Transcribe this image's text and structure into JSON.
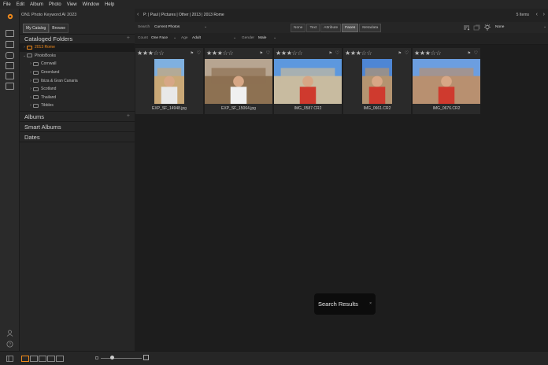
{
  "menu": [
    "File",
    "Edit",
    "Album",
    "Photo",
    "View",
    "Window",
    "Help"
  ],
  "app_title": "ON1 Photo Keyword AI 2023",
  "sidebar": {
    "tabs": [
      {
        "label": "My Catalog",
        "active": true
      },
      {
        "label": "Browse",
        "active": false
      }
    ],
    "cataloged_folders": "Cataloged Folders",
    "tree": [
      {
        "label": "2013 Rome",
        "depth": 1,
        "selected": true,
        "caret": "›"
      },
      {
        "label": "PhotoBooks",
        "depth": 1,
        "selected": false,
        "caret": "⌄"
      },
      {
        "label": "Cornwall",
        "depth": 2,
        "selected": false,
        "caret": "›"
      },
      {
        "label": "Greenland",
        "depth": 2,
        "selected": false,
        "caret": "›"
      },
      {
        "label": "Ibiza & Gran Canaria",
        "depth": 2,
        "selected": false,
        "caret": "›"
      },
      {
        "label": "Scotland",
        "depth": 2,
        "selected": false,
        "caret": "›"
      },
      {
        "label": "Thailand",
        "depth": 2,
        "selected": false,
        "caret": "›"
      },
      {
        "label": "Tibbles",
        "depth": 2,
        "selected": false,
        "caret": "›"
      }
    ],
    "albums": "Albums",
    "smart_albums": "Smart Albums",
    "dates": "Dates"
  },
  "topbar": {
    "breadcrumb": "P: | Paul | Pictures | Other | 2013 | 2013 Rome",
    "items": "5 Items"
  },
  "filter": {
    "search_label": "Search",
    "search_value": "Current Photos",
    "segments": [
      {
        "label": "None",
        "active": false
      },
      {
        "label": "Text",
        "active": false
      },
      {
        "label": "Attribute",
        "active": false
      },
      {
        "label": "Faces",
        "active": true
      },
      {
        "label": "Metadata",
        "active": false
      }
    ],
    "sort_value": "None"
  },
  "faces": {
    "count_label": "Count",
    "count_value": "One Face",
    "age_label": "Age",
    "age_value": "Adult",
    "gender_label": "Gender",
    "gender_value": "Male"
  },
  "photos": [
    {
      "name": "EXP_SF_14948.jpg",
      "stars": 3,
      "orient": "portrait",
      "sky": "#7fb0df",
      "ground": "#c9a877",
      "shirt": "#e8e8e8"
    },
    {
      "name": "EXP_SF_15064.jpg",
      "stars": 3,
      "orient": "landscape",
      "sky": "#b7a591",
      "ground": "#8d7152",
      "shirt": "#f0f0f0"
    },
    {
      "name": "IMG_0587.CR2",
      "stars": 3,
      "orient": "landscape",
      "sky": "#5d98de",
      "ground": "#c8bba0",
      "shirt": "#cf3a2e"
    },
    {
      "name": "IMG_0661.CR2",
      "stars": 3,
      "orient": "portrait",
      "sky": "#4e86d4",
      "ground": "#b49471",
      "shirt": "#cf3a2e"
    },
    {
      "name": "IMG_0676.CR2",
      "stars": 3,
      "orient": "landscape",
      "sky": "#6c9ee0",
      "ground": "#b89070",
      "shirt": "#cf3a2e"
    }
  ],
  "toast": {
    "label": "Search Results"
  },
  "colors": {
    "accent": "#f08a1c",
    "bg": "#1d1d1d",
    "panel": "#262626"
  }
}
